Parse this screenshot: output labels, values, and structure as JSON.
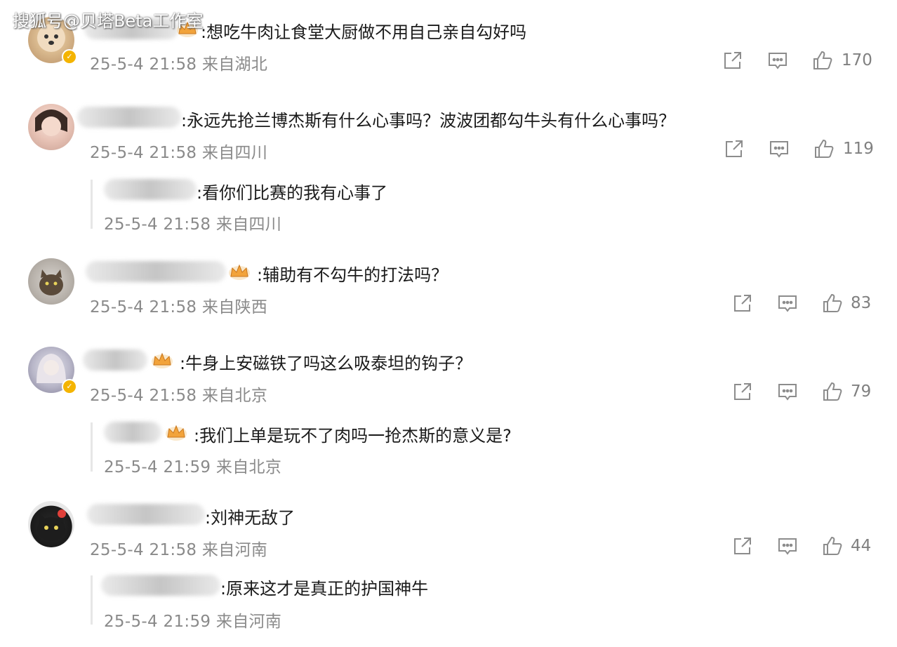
{
  "watermark": "搜狐号@贝塔Beta工作室",
  "comments": [
    {
      "text": ":想吃牛肉让食堂大厨做不用自己亲自勾好吗",
      "meta": "25-5-4 21:58 来自湖北",
      "likes": "170"
    },
    {
      "text": ":永远先抢兰博杰斯有什么心事吗？波波团都勾牛头有什么心事吗？",
      "meta": "25-5-4 21:58 来自四川",
      "likes": "119",
      "reply": {
        "text": ":看你们比赛的我有心事了",
        "meta": "25-5-4 21:58 来自四川"
      }
    },
    {
      "text": ":辅助有不勾牛的打法吗？",
      "meta": "25-5-4 21:58 来自陕西",
      "likes": "83"
    },
    {
      "text": ":牛身上安磁铁了吗这么吸泰坦的钩子？",
      "meta": "25-5-4 21:58 来自北京",
      "likes": "79",
      "reply": {
        "text": ":我们上单是玩不了肉吗一抢杰斯的意义是?",
        "meta": "25-5-4 21:59 来自北京"
      }
    },
    {
      "text": ":刘神无敌了",
      "meta": "25-5-4 21:58 来自河南",
      "likes": "44",
      "reply": {
        "text": ":原来这才是真正的护国神牛",
        "meta": "25-5-4 21:59 来自河南"
      }
    }
  ],
  "colors": {
    "meta": "#8a8a8a",
    "icon": "#8c8c8c",
    "badge": "#f4b400"
  },
  "icons": {
    "share": "share-icon",
    "comment": "comment-icon",
    "like": "thumbs-up-icon",
    "crown": "crown-icon",
    "verified": "verified-badge-icon"
  }
}
